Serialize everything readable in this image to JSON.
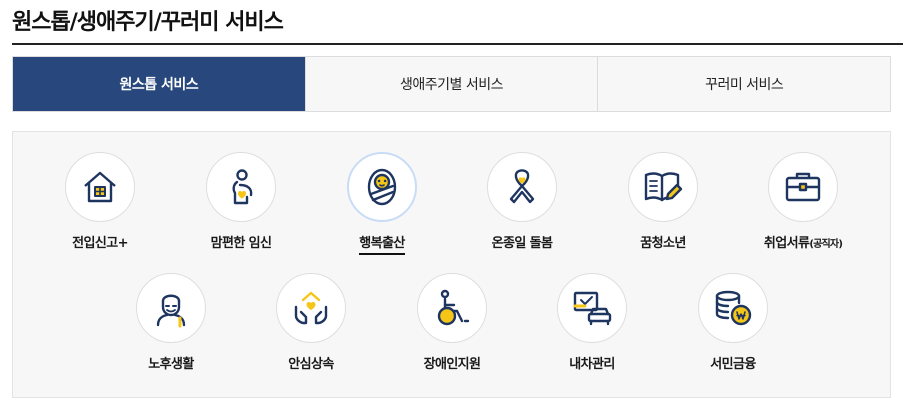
{
  "page": {
    "title": "원스톱/생애주기/꾸러미 서비스"
  },
  "tabs": [
    {
      "label": "원스톱 서비스",
      "active": true
    },
    {
      "label": "생애주기별 서비스",
      "active": false
    },
    {
      "label": "꾸러미 서비스",
      "active": false
    }
  ],
  "services": [
    {
      "label": "전입신고+",
      "icon": "house-icon"
    },
    {
      "label": "맘편한 임신",
      "icon": "pregnant-woman-icon"
    },
    {
      "label": "행복출산",
      "icon": "baby-icon",
      "selected": true
    },
    {
      "label": "온종일 돌봄",
      "icon": "ribbon-heart-icon"
    },
    {
      "label": "꿈청소년",
      "icon": "book-pencil-icon"
    },
    {
      "label": "취업서류",
      "sub": "(공직자)",
      "icon": "briefcase-icon"
    },
    {
      "label": "노후생활",
      "icon": "elderly-icon"
    },
    {
      "label": "안심상속",
      "icon": "hands-heart-house-icon"
    },
    {
      "label": "장애인지원",
      "icon": "wheelchair-icon"
    },
    {
      "label": "내차관리",
      "icon": "car-document-icon"
    },
    {
      "label": "서민금융",
      "icon": "coins-icon"
    }
  ],
  "colors": {
    "accent": "#28487d",
    "icon_stroke": "#1e3560",
    "icon_fill": "#f5c518"
  }
}
